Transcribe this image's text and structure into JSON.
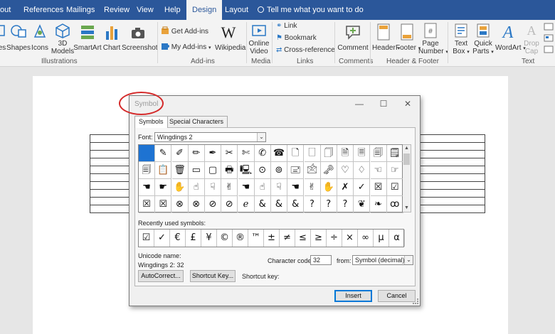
{
  "tabs": [
    "out",
    "References",
    "Mailings",
    "Review",
    "View",
    "Help",
    "Design",
    "Layout"
  ],
  "active_tab": "Design",
  "tell_me": "Tell me what you want to do",
  "ribbon": {
    "left_cut": "es",
    "shapes": "Shapes",
    "icons": "Icons",
    "models_3d": [
      "3D",
      "Models"
    ],
    "smartart": "SmartArt",
    "chart": "Chart",
    "screenshot": "Screenshot",
    "get_addins": "Get Add-ins",
    "my_addins": "My Add-ins",
    "wikipedia": "Wikipedia",
    "online_video": [
      "Online",
      "Video"
    ],
    "link": "Link",
    "bookmark": "Bookmark",
    "cross_reference": "Cross-reference",
    "comment": "Comment",
    "header": "Header",
    "footer": "Footer",
    "page_number": [
      "Page",
      "Number"
    ],
    "text_box": [
      "Text",
      "Box"
    ],
    "quick_parts": [
      "Quick",
      "Parts"
    ],
    "wordart": "WordArt",
    "drop_cap": [
      "Drop",
      "Cap"
    ],
    "groups": {
      "illustrations": "Illustrations",
      "addins": "Add-ins",
      "media": "Media",
      "links": "Links",
      "comments": "Comments",
      "header_footer": "Header & Footer",
      "text": "Text"
    },
    "icon_glyphs": {
      "shapes": "◇",
      "icons": "☺",
      "smartart": "▤",
      "chart": "▮",
      "screenshot": "▣",
      "wikipedia": "W",
      "comment": "+",
      "header": "▭",
      "footer": "▭",
      "page_number": "#",
      "textbox": "A",
      "quickparts": "▦",
      "wordart": "A",
      "dropcap": "A"
    },
    "colors": {
      "blue": "#2b579a",
      "orange": "#e9a23b",
      "green": "#6aa84f",
      "accent": "#2b78c5"
    }
  },
  "dialog": {
    "title": "Symbol",
    "tabs": [
      "Symbols",
      "Special Characters"
    ],
    "font_label": "Font:",
    "font_value": "Wingdings 2",
    "symbols": [
      [
        "",
        "✎",
        "✐",
        "✏",
        "✒",
        "✂",
        "✄",
        "✆",
        "☎",
        "🗋",
        "🗌",
        "🗍",
        "🗎",
        "🗏",
        "🗐",
        "🗒"
      ],
      [
        "🗐",
        "📋",
        "🗑",
        "▭",
        "▢",
        "🖶",
        "🖳",
        "⊙",
        "⊚",
        "🖃",
        "🖄",
        "🗝",
        "♡",
        "♢",
        "☜",
        "☞"
      ],
      [
        "☚",
        "☛",
        "✋",
        "☝",
        "☟",
        "✌",
        "☚",
        "☝",
        "☟",
        "☚",
        "✌",
        "✋",
        "✗",
        "✓",
        "☒",
        "☑"
      ],
      [
        "☒",
        "☒",
        "⊗",
        "⊗",
        "⊘",
        "⊘",
        "ℯ",
        "&",
        "&",
        "&",
        "?",
        "?",
        "?",
        "❦",
        "❧",
        "ꝏ"
      ]
    ],
    "selected_index": 0,
    "recent_label": "Recently used symbols:",
    "recent": [
      "☑",
      "✓",
      "€",
      "£",
      "¥",
      "©",
      "®",
      "™",
      "±",
      "≠",
      "≤",
      "≥",
      "÷",
      "×",
      "∞",
      "μ",
      "α"
    ],
    "unicode_name_label": "Unicode name:",
    "unicode_name_value": "Wingdings 2: 32",
    "char_code_label": "Character code:",
    "char_code_value": "32",
    "from_label": "from:",
    "from_value": "Symbol (decimal)",
    "autocorrect_label": "AutoCorrect...",
    "shortcut_key_button": "Shortcut Key...",
    "shortcut_key_label": "Shortcut key:",
    "insert_label": "Insert",
    "cancel_label": "Cancel",
    "minimize": "—",
    "maximize": "☐",
    "close": "✕",
    "scroll_up": "▲",
    "scroll_down": "▼",
    "dropdown_arrow": "⌄",
    "selection_color": "#1e73d2",
    "highlight_color": "#d42a2a"
  }
}
